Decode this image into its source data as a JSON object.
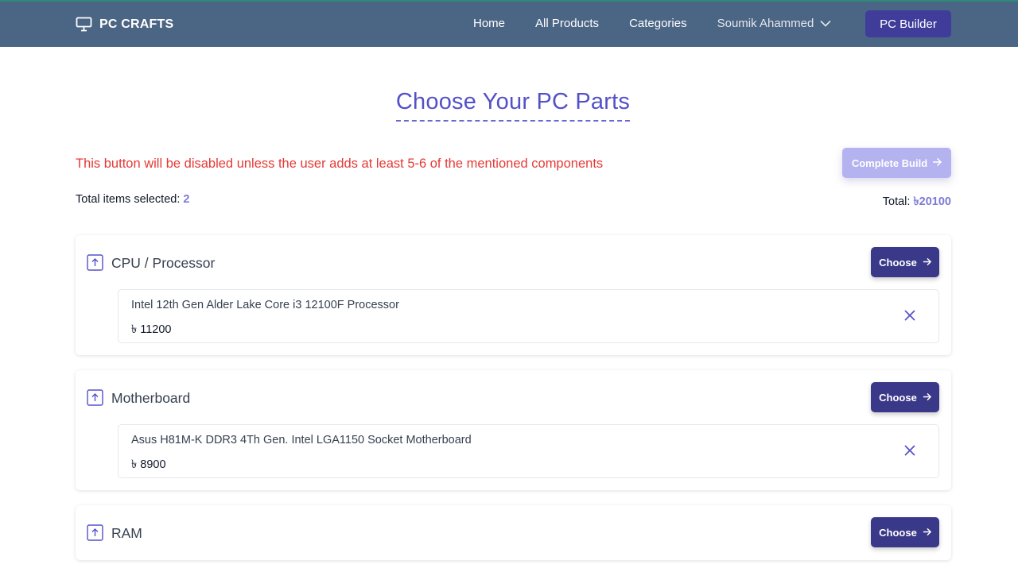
{
  "navbar": {
    "brand": "PC CRAFTS",
    "brand_icon": "monitor-icon",
    "links": [
      "Home",
      "All Products",
      "Categories"
    ],
    "user_name": "Soumik Ahammed",
    "builder_button": "PC Builder"
  },
  "page": {
    "title": "Choose Your PC Parts",
    "warning": "This button will be disabled unless the user adds at least 5-6 of the mentioned components",
    "complete_button": "Complete Build",
    "total_items_label": "Total items selected: ",
    "total_items_value": "2",
    "total_label": "Total: ",
    "total_value": "৳20100"
  },
  "categories": [
    {
      "name": "CPU / Processor",
      "choose_label": "Choose",
      "selected": {
        "name": "Intel 12th Gen Alder Lake Core i3 12100F Processor",
        "price": "৳ 11200"
      }
    },
    {
      "name": "Motherboard",
      "choose_label": "Choose",
      "selected": {
        "name": "Asus H81M-K DDR3 4Th Gen. Intel LGA1150 Socket Motherboard",
        "price": "৳ 8900"
      }
    },
    {
      "name": "RAM",
      "choose_label": "Choose",
      "selected": null
    }
  ],
  "colors": {
    "navbar": "#4b6584",
    "accent": "#5451c8",
    "button": "#3a3888",
    "warning": "#e53935",
    "disabled_button": "#b4b2ef"
  }
}
